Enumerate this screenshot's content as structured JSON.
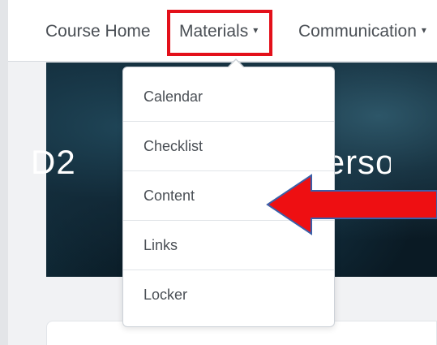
{
  "nav": {
    "home_label": "Course Home",
    "materials_label": "Materials",
    "communication_label": "Communication",
    "chevron": "▾"
  },
  "banner": {
    "title_left": "D2",
    "title_right": "nderso"
  },
  "dropdown": {
    "items": [
      {
        "label": "Calendar"
      },
      {
        "label": "Checklist"
      },
      {
        "label": "Content"
      },
      {
        "label": "Links"
      },
      {
        "label": "Locker"
      }
    ]
  },
  "annotations": {
    "highlight_color": "#e3101a",
    "arrow_fill": "#ee0f12",
    "arrow_stroke": "#3b5fa8",
    "arrow_icon": "left-arrow-icon"
  }
}
